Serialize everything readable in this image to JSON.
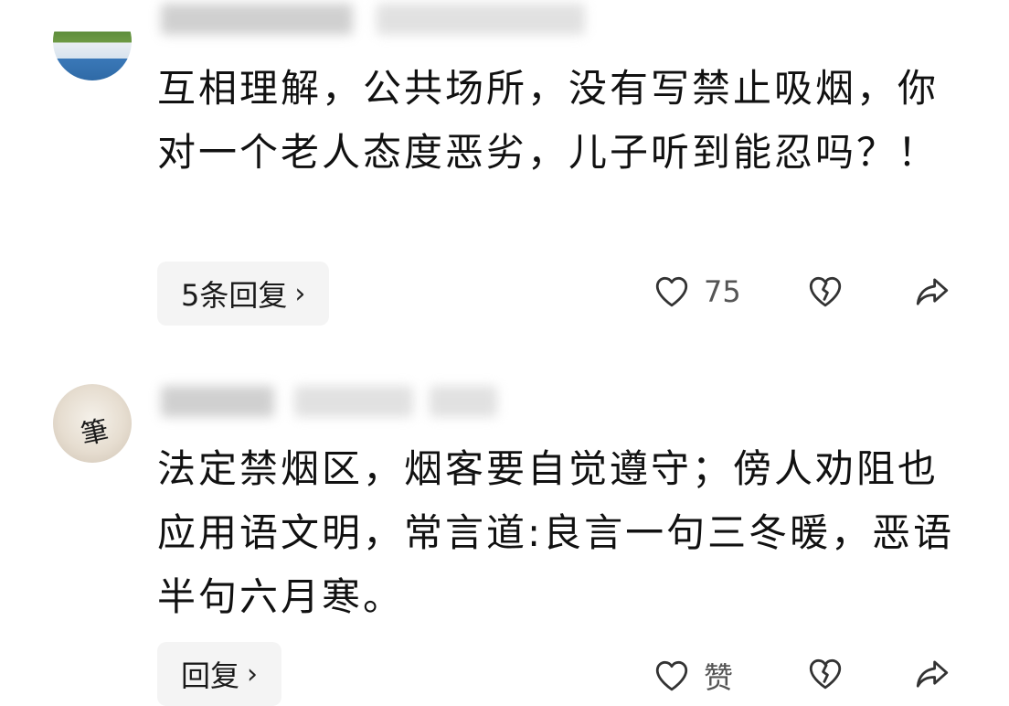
{
  "comments": [
    {
      "text": "互相理解，公共场所，没有写禁止吸烟，你对一个老人态度恶劣，儿子听到能忍吗？！",
      "reply_label": "5条回复",
      "like_label": "75",
      "avatar_icon": "landscape-avatar"
    },
    {
      "text": "法定禁烟区，烟客要自觉遵守；傍人劝阻也应用语文明，常言道:良言一句三冬暖，恶语半句六月寒。",
      "reply_label": "回复",
      "like_label": "赞",
      "avatar_icon": "calligraphy-avatar"
    }
  ],
  "icons": {
    "like": "heart-icon",
    "dislike": "broken-heart-icon",
    "share": "share-arrow-icon",
    "chevron": "›"
  },
  "colors": {
    "text": "#111111",
    "secondary": "#555555",
    "pill_bg": "#f4f4f4",
    "icon_stroke": "#333333"
  }
}
